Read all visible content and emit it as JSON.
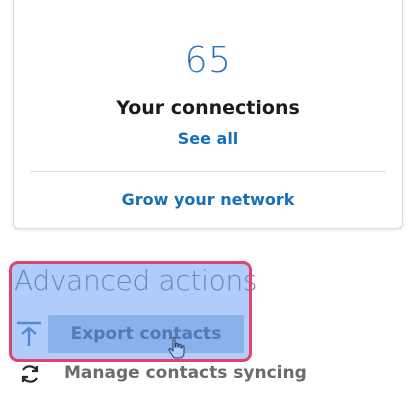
{
  "connections": {
    "count": "65",
    "title": "Your connections",
    "see_all_label": "See all",
    "grow_label": "Grow your network"
  },
  "advanced": {
    "title": "Advanced actions",
    "export_label": "Export contacts",
    "sync_label": "Manage contacts syncing"
  },
  "icons": {
    "export": "export-upload-icon",
    "sync": "sync-icon",
    "cursor": "hand-pointer-cursor"
  },
  "colors": {
    "accent": "#1770b7",
    "count": "#2e75b6",
    "highlight_fill": "#4285f4",
    "highlight_border": "#e2436a"
  }
}
